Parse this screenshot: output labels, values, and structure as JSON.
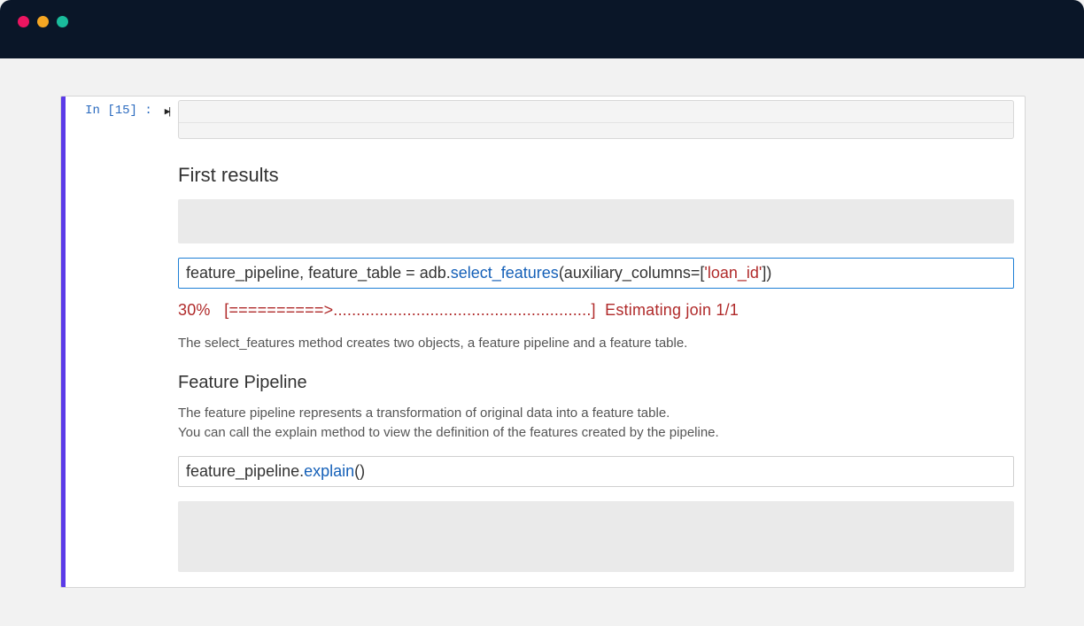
{
  "titlebar": {
    "buttons": {
      "close": "close",
      "min": "minimize",
      "max": "maximize"
    }
  },
  "cell": {
    "prompt": "In  [15] :",
    "run_glyph": "▶|"
  },
  "sections": {
    "first_results_heading": "First results",
    "feature_pipeline_heading": "Feature Pipeline"
  },
  "code1": {
    "pre": "feature_pipeline, feature_table = adb.",
    "func": "select_features",
    "mid": "(auxiliary_columns=[",
    "str": "'loan_id'",
    "post": "])"
  },
  "progress": {
    "pct": "30%",
    "bar": "[==========>........................................................]",
    "label": "Estimating join 1/1"
  },
  "desc1": "The select_features method creates two objects, a feature pipeline and a feature table.",
  "desc2_line1": "The feature pipeline represents a transformation of original data into a feature table.",
  "desc2_line2": "You can call the explain method to view the definition of the features created by the pipeline.",
  "code2": {
    "pre": "feature_pipeline.",
    "func": "explain",
    "post": "()"
  }
}
